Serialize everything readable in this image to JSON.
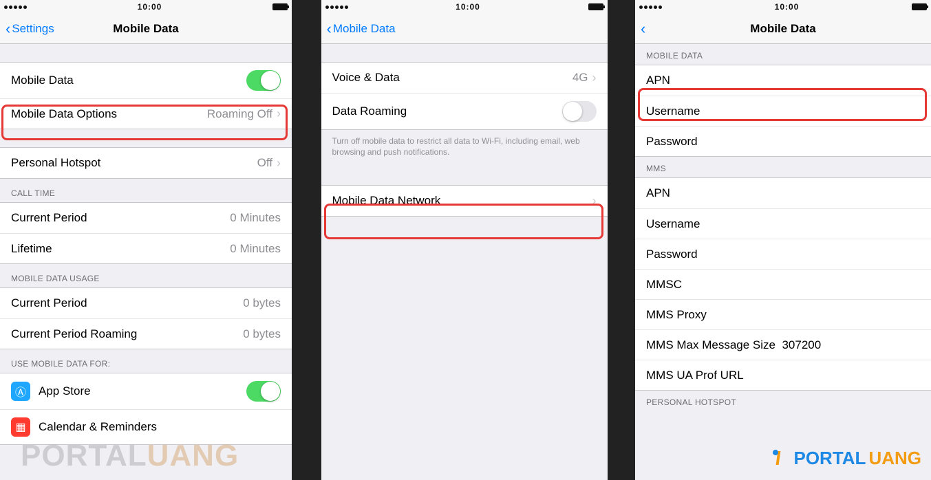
{
  "status": {
    "time": "10:00"
  },
  "screen1": {
    "back": "Settings",
    "title": "Mobile Data",
    "mobileData": "Mobile Data",
    "mobileDataOptions": {
      "label": "Mobile Data Options",
      "value": "Roaming Off"
    },
    "personalHotspot": {
      "label": "Personal Hotspot",
      "value": "Off"
    },
    "callTimeHeader": "CALL TIME",
    "currentPeriod": {
      "label": "Current Period",
      "value": "0 Minutes"
    },
    "lifetime": {
      "label": "Lifetime",
      "value": "0 Minutes"
    },
    "usageHeader": "MOBILE DATA USAGE",
    "usageCurrent": {
      "label": "Current Period",
      "value": "0 bytes"
    },
    "usageRoaming": {
      "label": "Current Period Roaming",
      "value": "0 bytes"
    },
    "useForHeader": "USE MOBILE DATA FOR:",
    "appStore": "App Store",
    "calendar": "Calendar & Reminders"
  },
  "screen2": {
    "back": "Mobile Data",
    "voiceData": {
      "label": "Voice & Data",
      "value": "4G"
    },
    "dataRoaming": "Data Roaming",
    "footer": "Turn off mobile data to restrict all data to Wi-Fi, including email, web browsing and push notifications.",
    "mobileDataNetwork": "Mobile Data Network"
  },
  "screen3": {
    "title": "Mobile Data",
    "mobileDataHeader": "MOBILE DATA",
    "apn": "APN",
    "username": "Username",
    "password": "Password",
    "mmsHeader": "MMS",
    "mmsc": "MMSC",
    "mmsProxy": "MMS Proxy",
    "mmsMax": {
      "label": "MMS Max Message Size",
      "value": "307200"
    },
    "mmsUaProf": "MMS UA Prof URL",
    "personalHotspotHeader": "PERSONAL HOTSPOT"
  },
  "watermark": {
    "p": "PORTAL",
    "u": "UANG"
  }
}
